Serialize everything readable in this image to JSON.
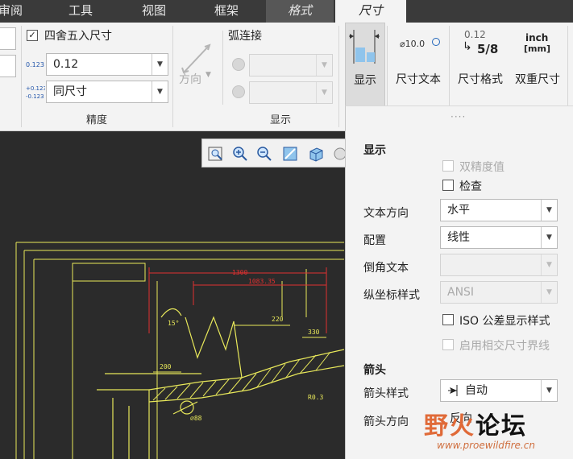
{
  "menubar": {
    "items": [
      {
        "label": "审阅"
      },
      {
        "label": "工具"
      },
      {
        "label": "视图"
      },
      {
        "label": "框架"
      },
      {
        "label": "格式"
      },
      {
        "label": "尺寸"
      }
    ]
  },
  "ribbon": {
    "precision": {
      "round_label": "四舍五入尺寸",
      "round_checked": true,
      "value": "0.12",
      "tolerance": "同尺寸",
      "group_title": "精度"
    },
    "display": {
      "direction_label": "方向",
      "arc_label": "弧连接",
      "group_title": "显示"
    },
    "tools": {
      "display_label": "显示",
      "dim_text_label": "尺寸文本",
      "dim_format_label": "尺寸格式",
      "dual_dim_label": "双重尺寸",
      "dim_text_icon": "⌀10.0",
      "format_icon_top": "0.12",
      "format_icon_bottom": "5/8",
      "dual_icon_top": "inch",
      "dual_icon_bottom": "[mm]"
    }
  },
  "drawing": {
    "dims": [
      "1300",
      "1083.35",
      "15°",
      "220",
      "330",
      "200",
      "R0.3",
      "⌀88"
    ]
  },
  "panel": {
    "grip": "····",
    "display_section": "显示",
    "dual_precision": "双精度值",
    "inspect": "检查",
    "text_orientation_label": "文本方向",
    "text_orientation_value": "水平",
    "config_label": "配置",
    "config_value": "线性",
    "chamfer_label": "倒角文本",
    "ordinate_label": "纵坐标样式",
    "ordinate_value": "ANSI",
    "iso_tol": "ISO 公差显示样式",
    "intersect": "启用相交尺寸界线",
    "arrow_section": "箭头",
    "arrow_style_label": "箭头样式",
    "arrow_style_value": "自动",
    "arrow_dir_label": "箭头方向",
    "arrow_dir_value": "反向"
  },
  "watermark": {
    "text_a": "野",
    "text_b": "火",
    "text_c": "论坛",
    "url": "www.proewildfire.cn"
  },
  "colors": {
    "drawing_line": "#e8e85a",
    "dimension": "#e03030",
    "brand": "#e06a38"
  }
}
